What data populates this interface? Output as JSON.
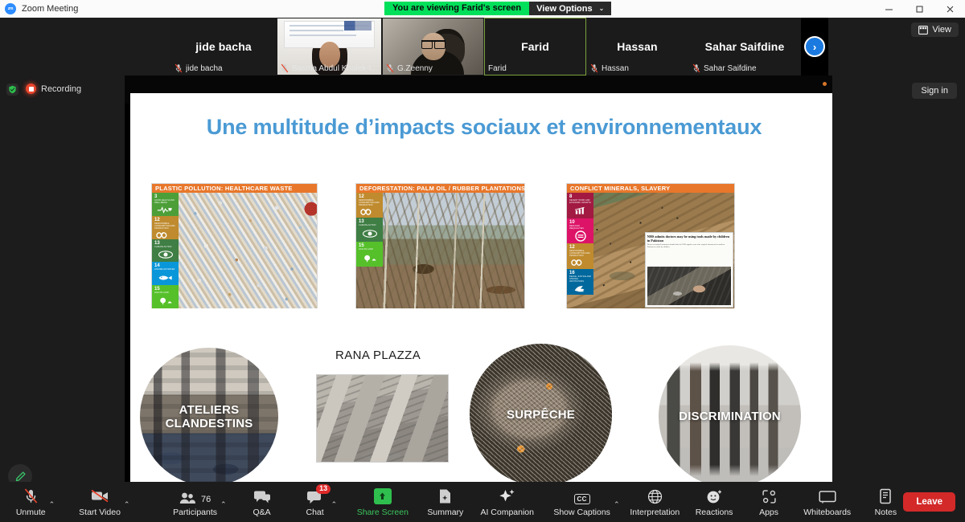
{
  "window": {
    "app_icon": "zoom-logo-icon",
    "title": "Zoom Meeting",
    "minimize": "–",
    "maximize": "▫",
    "close": "✕"
  },
  "share_banner": {
    "message": "You are viewing Farid's screen",
    "view_options_label": "View Options",
    "caret": "⌄"
  },
  "status": {
    "encryption_icon": "green-shield-icon",
    "recording_label": "Recording"
  },
  "right_controls": {
    "view_label": "View",
    "view_icon": "layout-grid-icon",
    "signin_label": "Sign in",
    "annotate_icon": "pencil-icon"
  },
  "filmstrip": {
    "next_arrow": "›",
    "participants": [
      {
        "display_name": "jide bacha",
        "footer_name": "jide bacha",
        "muted": true,
        "video_on": false,
        "active_speaker": false,
        "width": 132
      },
      {
        "display_name": "Basma Abdul Khalek-I...",
        "footer_name": "Basma Abdul Khalek-I...",
        "muted": true,
        "video_on": true,
        "active_speaker": false,
        "width": 131
      },
      {
        "display_name": "G.Zeenny",
        "footer_name": "G.Zeenny",
        "muted": true,
        "video_on": true,
        "active_speaker": false,
        "width": 127
      },
      {
        "display_name": "Farid",
        "footer_name": "Farid",
        "muted": false,
        "video_on": false,
        "active_speaker": true,
        "width": 127
      },
      {
        "display_name": "Hassan",
        "footer_name": "Hassan",
        "muted": true,
        "video_on": false,
        "active_speaker": false,
        "width": 127
      },
      {
        "display_name": "Sahar Saifdine",
        "footer_name": "Sahar Saifdine",
        "muted": true,
        "video_on": false,
        "active_speaker": false,
        "width": 140
      }
    ]
  },
  "slide": {
    "title": "Une multitude d’impacts sociaux et environnementaux",
    "title_color": "#4a9ad4",
    "header_color": "#e8772b",
    "cards": [
      {
        "header": "PLASTIC POLLUTION: HEALTHCARE WASTE",
        "photo": "plastic-waste-photo",
        "sdgs": [
          {
            "num": "3",
            "txt": "GOOD HEALTH AND WELL-BEING",
            "color": "#4C9F38",
            "glyph": "♡"
          },
          {
            "num": "12",
            "txt": "RESPONSIBLE CONSUMPTION AND PRODUCTION",
            "color": "#BF8B2E",
            "glyph": "∞"
          },
          {
            "num": "13",
            "txt": "CLIMATE ACTION",
            "color": "#3F7E44",
            "glyph": "◉"
          },
          {
            "num": "14",
            "txt": "LIFE BELOW WATER",
            "color": "#0A97D9",
            "glyph": "🐟"
          },
          {
            "num": "15",
            "txt": "LIFE ON LAND",
            "color": "#56C02B",
            "glyph": "🌳"
          }
        ]
      },
      {
        "header": "DEFORESTATION: PALM OIL / RUBBER PLANTATIONS",
        "photo": "deforestation-photo",
        "sdgs": [
          {
            "num": "12",
            "txt": "RESPONSIBLE CONSUMPTION AND PRODUCTION",
            "color": "#BF8B2E",
            "glyph": "∞"
          },
          {
            "num": "13",
            "txt": "CLIMATE ACTION",
            "color": "#3F7E44",
            "glyph": "◉"
          },
          {
            "num": "15",
            "txt": "LIFE ON LAND",
            "color": "#56C02B",
            "glyph": "🌳"
          }
        ]
      },
      {
        "header": "CONFLICT MINERALS, SLAVERY",
        "photo": "mining-photo",
        "news_headline": "NHS admits doctors may be using tools made by children in Pakistan",
        "news_sub": "Dozens of surgical instrument brands linked to NHS supplies come after surgical instruments in northern Pakistan are made by children.",
        "sdgs": [
          {
            "num": "8",
            "txt": "DECENT WORK AND ECONOMIC GROWTH",
            "color": "#A21942",
            "glyph": "📈"
          },
          {
            "num": "10",
            "txt": "REDUCED INEQUALITIES",
            "color": "#DD1367",
            "glyph": "≡"
          },
          {
            "num": "12",
            "txt": "RESPONSIBLE CONSUMPTION AND PRODUCTION",
            "color": "#BF8B2E",
            "glyph": "∞"
          },
          {
            "num": "16",
            "txt": "PEACE, JUSTICE AND STRONG INSTITUTIONS",
            "color": "#00689D",
            "glyph": "🕊"
          }
        ]
      }
    ],
    "circles": [
      {
        "label": "ATELIERS\nCLANDESTINS",
        "photo": "sweatshop-photo"
      },
      {
        "label": "SURPÊCHE",
        "photo": "overfishing-photo"
      },
      {
        "label": "DISCRIMINATION",
        "photo": "discrimination-photo"
      }
    ],
    "rana": {
      "title": "RANA PLAZZA",
      "photo": "rana-plaza-collapse-photo"
    }
  },
  "toolbar": {
    "items": [
      {
        "name": "unmute",
        "label": "Unmute",
        "icon": "mic-off-icon",
        "chevron": true,
        "green": false
      },
      {
        "name": "start-video",
        "label": "Start Video",
        "icon": "video-off-icon",
        "chevron": true,
        "green": false
      },
      {
        "name": "participants",
        "label": "Participants",
        "icon": "people-icon",
        "chevron": true,
        "green": false,
        "count": "76"
      },
      {
        "name": "qa",
        "label": "Q&A",
        "icon": "chat-bubbles-icon",
        "chevron": false,
        "green": false
      },
      {
        "name": "chat",
        "label": "Chat",
        "icon": "chat-bubble-icon",
        "chevron": true,
        "green": false,
        "badge": "13"
      },
      {
        "name": "share-screen",
        "label": "Share Screen",
        "icon": "share-up-arrow-icon",
        "chevron": false,
        "green": true
      },
      {
        "name": "summary",
        "label": "Summary",
        "icon": "document-ai-icon",
        "chevron": false,
        "green": false
      },
      {
        "name": "ai-companion",
        "label": "AI Companion",
        "icon": "sparkle-icon",
        "chevron": false,
        "green": false
      },
      {
        "name": "show-captions",
        "label": "Show Captions",
        "icon": "cc-icon",
        "chevron": true,
        "green": false
      },
      {
        "name": "interpretation",
        "label": "Interpretation",
        "icon": "globe-icon",
        "chevron": false,
        "green": false
      },
      {
        "name": "reactions",
        "label": "Reactions",
        "icon": "smiley-plus-icon",
        "chevron": false,
        "green": false
      },
      {
        "name": "apps",
        "label": "Apps",
        "icon": "apps-icon",
        "chevron": false,
        "green": false
      },
      {
        "name": "whiteboards",
        "label": "Whiteboards",
        "icon": "whiteboard-icon",
        "chevron": false,
        "green": false
      },
      {
        "name": "notes",
        "label": "Notes",
        "icon": "notes-icon",
        "chevron": false,
        "green": false
      }
    ],
    "leave_label": "Leave"
  }
}
